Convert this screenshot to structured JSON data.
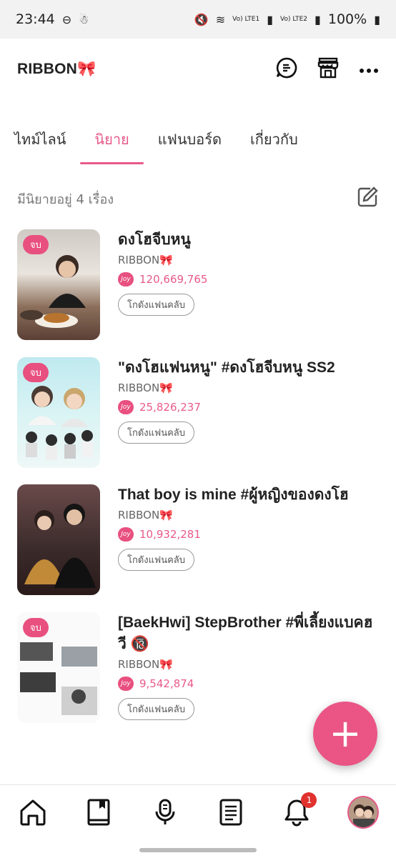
{
  "status_bar": {
    "time": "23:44",
    "battery": "100%",
    "sim1": "Vo) LTE1",
    "sim2": "Vo) LTE2"
  },
  "header": {
    "title": "RIBBON🎀"
  },
  "tabs": [
    {
      "label": "ไทม์ไลน์"
    },
    {
      "label": "นิยาย"
    },
    {
      "label": "แฟนบอร์ด"
    },
    {
      "label": "เกี่ยวกับ"
    }
  ],
  "novel_count_text": "มีนิยายอยู่ 4 เรื่อง",
  "novels": [
    {
      "title": "ดงโฮจีบหนู",
      "author": "RIBBON🎀",
      "views": "120,669,765",
      "badge": "จบ",
      "fanclub_label": "โกดังแฟนคลับ"
    },
    {
      "title": "\"ดงโฮแฟนหนู\" #ดงโฮจีบหนู SS2",
      "author": "RIBBON🎀",
      "views": "25,826,237",
      "badge": "จบ",
      "fanclub_label": "โกดังแฟนคลับ"
    },
    {
      "title": "That boy is mine #ผู้หญิงของดงโฮ",
      "author": "RIBBON🎀",
      "views": "10,932,281",
      "badge": "",
      "fanclub_label": "โกดังแฟนคลับ"
    },
    {
      "title": "[BaekHwi] StepBrother #พี่เลี้ยงแบคฮวี 🔞",
      "author": "RIBBON🎀",
      "views": "9,542,874",
      "badge": "จบ",
      "fanclub_label": "โกดังแฟนคลับ"
    }
  ],
  "joy_label": "Joy",
  "fab_symbol": "+",
  "nav": {
    "notification_count": "1"
  },
  "colors": {
    "accent": "#e85a8a",
    "badge": "#e8507f"
  }
}
